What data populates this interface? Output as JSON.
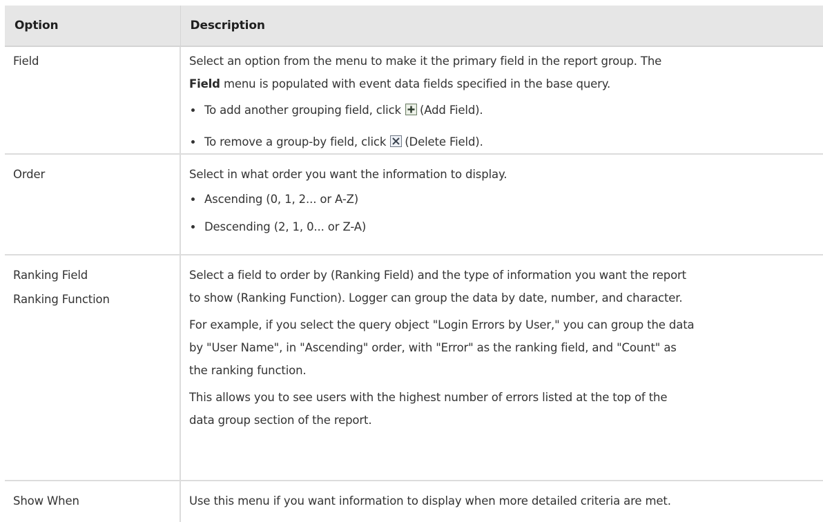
{
  "header": {
    "option_label": "Option",
    "description_label": "Description"
  },
  "rows": [
    {
      "option": "Field",
      "desc_line1": "Select an option from the menu to make it the primary field in the report group. The",
      "desc_bold": "Field",
      "desc_line2_rest": " menu is populated with event data fields specified in the base query.",
      "bullet1_pre": "To add another grouping field, click",
      "bullet1_post": "(Add Field).",
      "bullet2_pre": "To remove a group-by field, click",
      "bullet2_post": "(Delete Field)."
    },
    {
      "option": "Order",
      "desc": "Select in what order you want the information to display.",
      "bullet1": "Ascending (0, 1, 2... or A-Z)",
      "bullet2": "Descending (2, 1, 0... or Z-A)"
    },
    {
      "option_line1": "Ranking Field",
      "option_line2": "Ranking Function",
      "p1_line1": "Select a field to order by (Ranking Field) and the type of information you want the report",
      "p1_line2": "to show (Ranking Function). Logger can group the data by date, number, and character.",
      "p2_line1": "For example, if you select the query object \"Login Errors by User,\" you can group the data",
      "p2_line2": "by \"User Name\", in \"Ascending\" order, with \"Error\" as the ranking field, and \"Count\" as",
      "p2_line3": "the ranking function.",
      "p3_line1": "This allows you to see users with the highest number of errors listed at the top of the",
      "p3_line2": "data group section of the report."
    },
    {
      "option": "Show When",
      "desc": "Use this menu if you want information to display when more detailed criteria are met."
    }
  ],
  "icons": {
    "add": "plus-box-icon",
    "delete": "x-box-icon"
  }
}
